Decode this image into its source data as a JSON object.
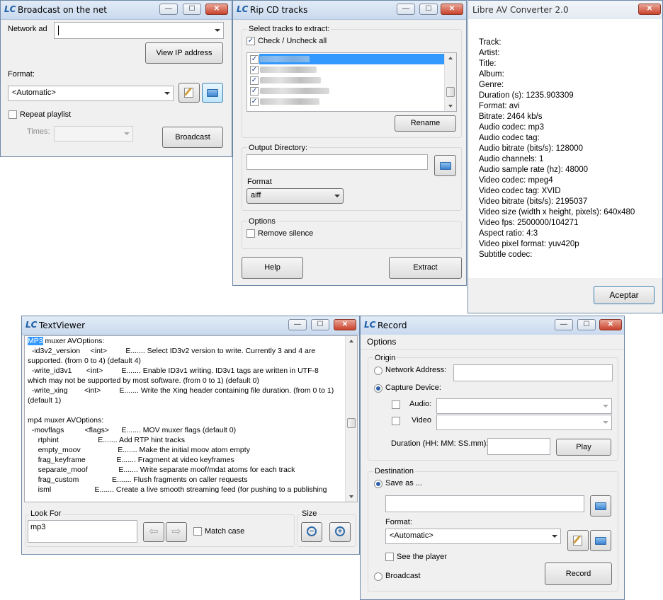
{
  "broadcast": {
    "title": "Broadcast on the net",
    "network_label": "Network ad",
    "network_value": "",
    "view_ip_button": "View IP address",
    "format_label": "Format:",
    "format_value": "<Automatic>",
    "repeat_label": "Repeat playlist",
    "times_label": "Times:",
    "broadcast_button": "Broadcast"
  },
  "rip": {
    "title": "Rip CD tracks",
    "select_label": "Select tracks to extract:",
    "check_all_label": "Check / Uncheck all",
    "rename_button": "Rename",
    "output_label": "Output Directory:",
    "output_value": "",
    "format_label": "Format",
    "format_value": "aiff",
    "options_label": "Options",
    "remove_silence_label": "Remove silence",
    "help_button": "Help",
    "extract_button": "Extract"
  },
  "converter": {
    "title": "Libre AV Converter 2.0",
    "info_lines": [
      "Track:",
      "Artist:",
      "Title:",
      "Album:",
      "Genre:",
      "Duration (s): 1235.903309",
      "Format:  avi",
      "Bitrate:  2464 kb/s",
      "Audio codec: mp3",
      "Audio codec tag:",
      "Audio bitrate (bits/s): 128000",
      "Audio channels: 1",
      "Audio sample rate (hz): 48000",
      "Video codec: mpeg4",
      "Video codec tag: XVID",
      "Video bitrate (bits/s): 2195037",
      "Video size (width x height, pixels): 640x480",
      "Video fps: 2500000/104271",
      "Aspect ratio: 4:3",
      "Video pixel format: yuv420p",
      "Subtitle codec:"
    ],
    "accept_button": "Aceptar"
  },
  "textviewer": {
    "title": "TextViewer",
    "highlight": "MP3",
    "first_line_rest": " muxer AVOptions:",
    "lines": [
      "  -id3v2_version     <int>         E....... Select ID3v2 version to write. Currently 3 and 4 are",
      "supported. (from 0 to 4) (default 4)",
      "  -write_id3v1       <int>         E....... Enable ID3v1 writing. ID3v1 tags are written in UTF-8",
      "which may not be supported by most software. (from 0 to 1) (default 0)",
      "  -write_xing        <int>         E....... Write the Xing header containing file duration. (from 0 to 1)",
      "(default 1)",
      "",
      "mp4 muxer AVOptions:",
      "  -movflags          <flags>      E....... MOV muxer flags (default 0)",
      "     rtphint                   E....... Add RTP hint tracks",
      "     empty_moov                  E....... Make the initial moov atom empty",
      "     frag_keyframe               E....... Fragment at video keyframes",
      "     separate_moof               E....... Write separate moof/mdat atoms for each track",
      "     frag_custom                E....... Flush fragments on caller requests",
      "     isml                     E....... Create a live smooth streaming feed (for pushing to a publishing"
    ],
    "look_for_label": "Look For",
    "look_for_value": "mp3",
    "match_case_label": "Match case",
    "size_label": "Size"
  },
  "record": {
    "title": "Record",
    "menu_options": "Options",
    "origin_label": "Origin",
    "network_address_label": "Network Address:",
    "capture_device_label": "Capture Device:",
    "audio_label": "Audio:",
    "video_label": "Video",
    "duration_label": "Duration (HH: MM: SS.mm):",
    "play_button": "Play",
    "destination_label": "Destination",
    "save_as_label": "Save as ...",
    "format_label": "Format:",
    "format_value": "<Automatic>",
    "see_player_label": "See the player",
    "broadcast_label": "Broadcast",
    "record_button": "Record"
  },
  "icons": {
    "app_logo": "LC",
    "minimize": "—",
    "maximize": "☐",
    "close": "✕",
    "check": "✓",
    "arrow_left": "⇦",
    "arrow_right": "⇨",
    "zoom_out": "−",
    "zoom_in": "+"
  }
}
